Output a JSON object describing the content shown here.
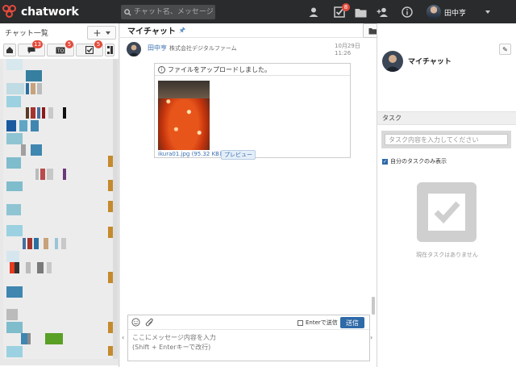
{
  "app": {
    "brand": "chatwork"
  },
  "search": {
    "placeholder": "チャット名、メッセージ"
  },
  "topbar": {
    "task_badge": "8",
    "user_name": "田中亨"
  },
  "sidebar": {
    "title": "チャット一覧",
    "add_label": "+",
    "filters": [
      {
        "name": "home",
        "badge": ""
      },
      {
        "name": "mention",
        "badge": "13"
      },
      {
        "name": "to",
        "badge": "5"
      },
      {
        "name": "task",
        "badge": "5"
      },
      {
        "name": "list-toggle",
        "badge": ""
      }
    ]
  },
  "room": {
    "title": "マイチャット"
  },
  "message": {
    "sender": "田中亨",
    "organization": "株式会社デジタルファーム",
    "time": "10月29日 11:26",
    "file_notice": "ファイルをアップロードしました。",
    "file_name": "ikura01.jpg (95.32 KB)",
    "preview_label": "プレビュー"
  },
  "composer": {
    "enter_to_send": "Enterで送信",
    "send_label": "送信",
    "placeholder": "ここにメッセージ内容を入力\n(Shift + Enterキーで改行)"
  },
  "right_panel": {
    "room_name": "マイチャット",
    "task_section": "タスク",
    "task_placeholder": "タスク内容を入力してください",
    "my_tasks_only": "自分のタスクのみ表示",
    "no_tasks": "現在タスクはありません"
  },
  "colors": {
    "brand_red": "#e44a3b",
    "topbar": "#2a2b2d",
    "link_blue": "#3a6fb0",
    "button_blue": "#2f6aa8"
  }
}
